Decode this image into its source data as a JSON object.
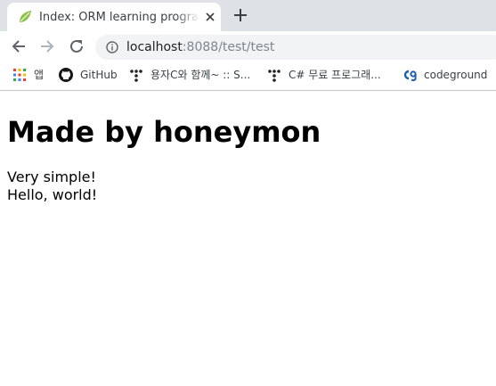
{
  "tab": {
    "title": "Index: ORM learning programming"
  },
  "address": {
    "host": "localhost",
    "rest": ":8088/test/test"
  },
  "bookmarks": [
    {
      "label": "앱"
    },
    {
      "label": "GitHub"
    },
    {
      "label": "용자C와 함께~ :: S..."
    },
    {
      "label": "C# 무료 프로그래..."
    },
    {
      "label": "codeground"
    }
  ],
  "page": {
    "heading": "Made by honeymon",
    "lines": [
      "Very simple!",
      "Hello, world!"
    ]
  },
  "colors": {
    "tabstrip": "#dee1e6",
    "omnibox": "#f1f3f4",
    "favicon_leaf": "#8bc34a",
    "codeground_logo": "#1a5fb4"
  }
}
